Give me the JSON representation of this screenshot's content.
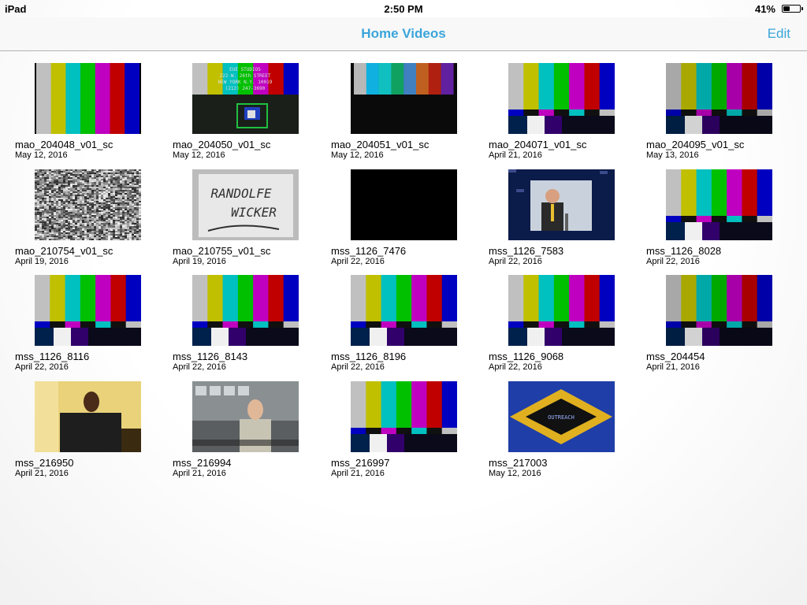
{
  "status_bar": {
    "device": "iPad",
    "time": "2:50 PM",
    "battery": "41%",
    "battery_level": 0.41
  },
  "nav": {
    "title": "Home Videos",
    "edit_label": "Edit"
  },
  "videos": [
    {
      "title": "mao_204048_v01_sc",
      "date": "May 12, 2016",
      "thumb": "bars-simple"
    },
    {
      "title": "mao_204050_v01_sc",
      "date": "May 12, 2016",
      "thumb": "studio-card"
    },
    {
      "title": "mao_204051_v01_sc",
      "date": "May 12, 2016",
      "thumb": "bars-dark"
    },
    {
      "title": "mao_204071_v01_sc",
      "date": "April 21, 2016",
      "thumb": "smpte-bars"
    },
    {
      "title": "mao_204095_v01_sc",
      "date": "May 13, 2016",
      "thumb": "smpte-bars-dim"
    },
    {
      "title": "mao_210754_v01_sc",
      "date": "April 19, 2016",
      "thumb": "static-noise"
    },
    {
      "title": "mao_210755_v01_sc",
      "date": "April 19, 2016",
      "thumb": "handwritten-card"
    },
    {
      "title": "mss_1126_7476",
      "date": "April 22, 2016",
      "thumb": "black"
    },
    {
      "title": "mss_1126_7583",
      "date": "April 22, 2016",
      "thumb": "speaker-podium"
    },
    {
      "title": "mss_1126_8028",
      "date": "April 22, 2016",
      "thumb": "smpte-bars"
    },
    {
      "title": "mss_1126_8116",
      "date": "April 22, 2016",
      "thumb": "smpte-bars"
    },
    {
      "title": "mss_1126_8143",
      "date": "April 22, 2016",
      "thumb": "smpte-bars"
    },
    {
      "title": "mss_1126_8196",
      "date": "April 22, 2016",
      "thumb": "smpte-bars"
    },
    {
      "title": "mss_1126_9068",
      "date": "April 22, 2016",
      "thumb": "smpte-bars"
    },
    {
      "title": "mss_204454",
      "date": "April 21, 2016",
      "thumb": "smpte-bars-dim"
    },
    {
      "title": "mss_216950",
      "date": "April 21, 2016",
      "thumb": "seated-man"
    },
    {
      "title": "mss_216994",
      "date": "April 21, 2016",
      "thumb": "control-room-man"
    },
    {
      "title": "mss_216997",
      "date": "April 21, 2016",
      "thumb": "smpte-bars"
    },
    {
      "title": "mss_217003",
      "date": "May 12, 2016",
      "thumb": "outreach-logo"
    }
  ],
  "thumb_text": {
    "studio_lines": [
      "EUE STUDIOS",
      "222 W. 26th STREET",
      "NEW YORK N.Y. 10019",
      "(212) 247-3690"
    ],
    "handwritten_lines": [
      "RANDOLFE",
      "WICKER"
    ],
    "logo_text": "OUTREACH"
  },
  "colors": {
    "accent": "#3aa5da"
  }
}
